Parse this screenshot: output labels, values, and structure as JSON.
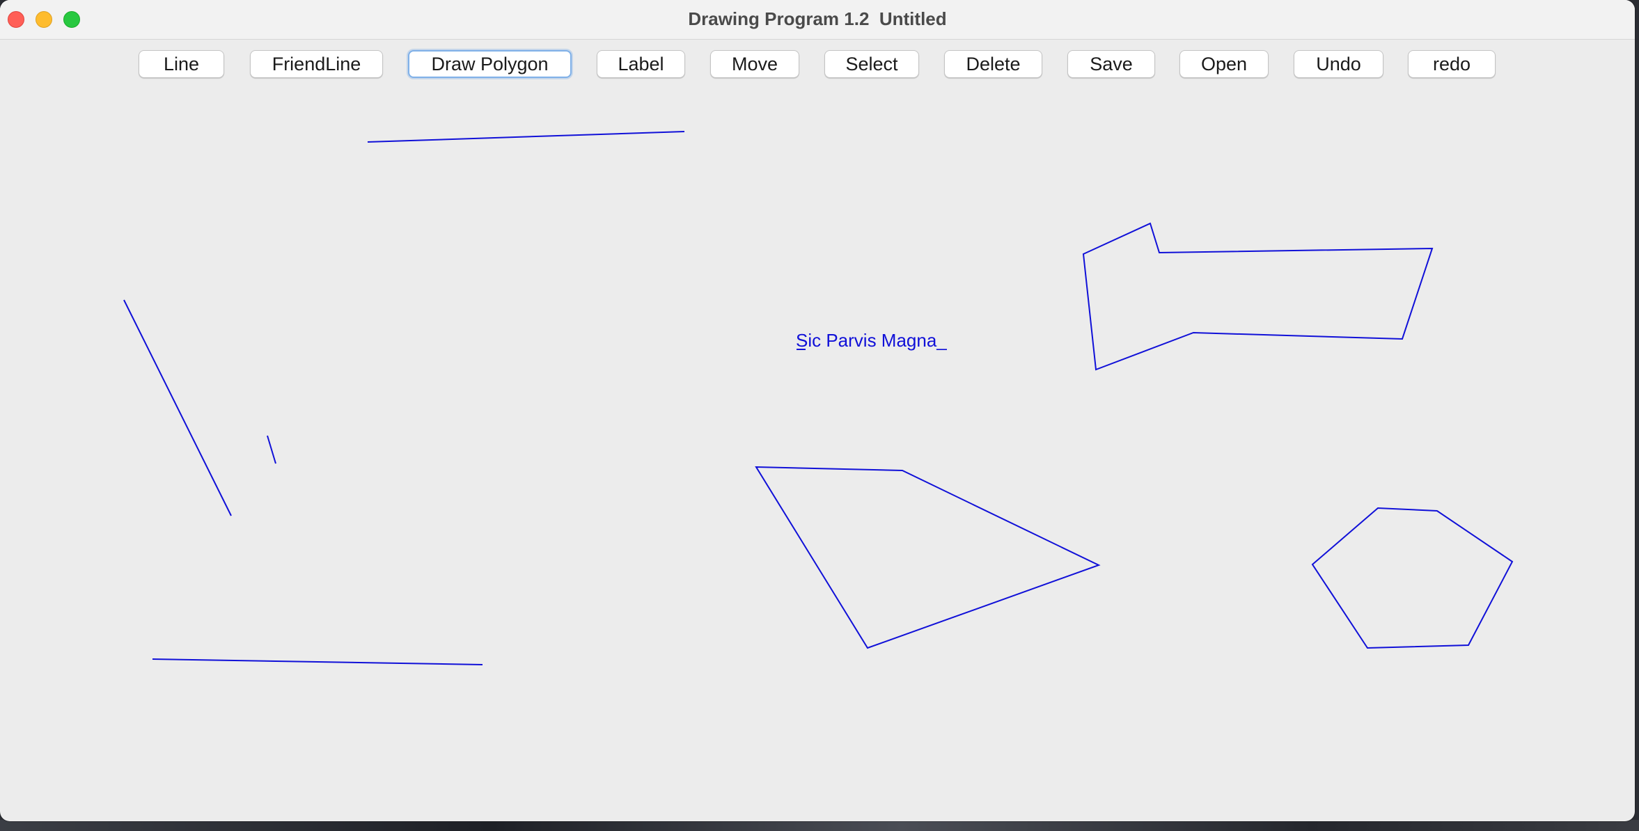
{
  "window": {
    "title": "Drawing Program 1.2  Untitled",
    "active_tool": "Draw Polygon",
    "stroke_color": "#1010d8"
  },
  "toolbar": {
    "line_label": "Line",
    "friendline_label": "FriendLine",
    "draw_polygon_label": "Draw Polygon",
    "label_label": "Label",
    "move_label": "Move",
    "select_label": "Select",
    "delete_label": "Delete",
    "save_label": "Save",
    "open_label": "Open",
    "undo_label": "Undo",
    "redo_label": "redo"
  },
  "canvas": {
    "label_text": "Sic Parvis Magna_"
  }
}
